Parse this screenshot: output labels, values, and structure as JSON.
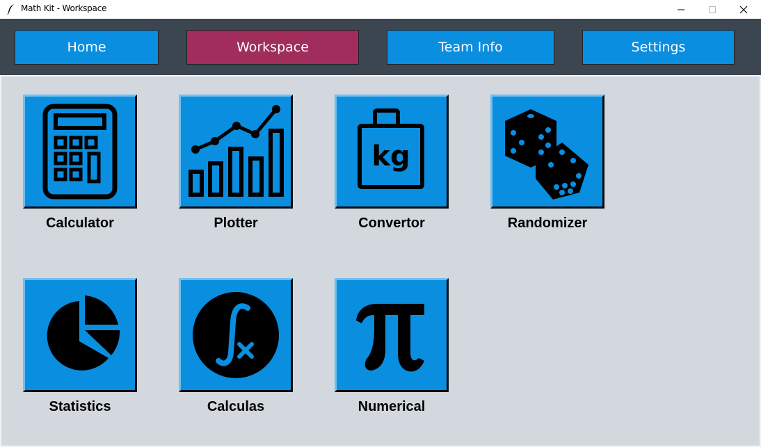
{
  "window": {
    "title": "Math Kit - Workspace",
    "minimize_glyph": "—",
    "maximize_glyph": "☐",
    "close_glyph": "✕"
  },
  "nav": {
    "items": [
      {
        "label": "Home"
      },
      {
        "label": "Workspace",
        "active": true
      },
      {
        "label": "Team Info"
      },
      {
        "label": "Settings"
      }
    ]
  },
  "tools": [
    {
      "label": "Calculator",
      "icon": "calculator-icon"
    },
    {
      "label": "Plotter",
      "icon": "plot-chart-icon"
    },
    {
      "label": "Convertor",
      "icon": "kg-weight-icon",
      "icon_text": "kg"
    },
    {
      "label": "Randomizer",
      "icon": "dice-icon"
    },
    {
      "label": "Statistics",
      "icon": "pie-chart-icon"
    },
    {
      "label": "Calculas",
      "icon": "integral-icon"
    },
    {
      "label": "Numerical",
      "icon": "pi-icon"
    }
  ],
  "colors": {
    "nav_bg": "#3b4651",
    "button_blue": "#0a8ee0",
    "active_button": "#a02d5b",
    "workspace_bg": "#d3d7de"
  }
}
